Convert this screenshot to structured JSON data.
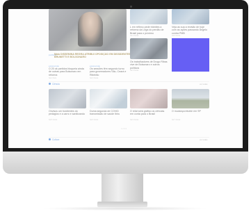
{
  "hero": {
    "category": "política",
    "headline": "Maia DISSEMINA REGRA ATRIBUI OPOSIÇÃO EM DISSIDENTES BRUNETTI E BOLSONARO"
  },
  "right_top": [
    {
      "text": "L em reflexo pede trâmites a reforma da Lega do perdão de Brasil para o próximo",
      "meta": "há 2 horas"
    },
    {
      "text": "Veja as sua a revisão de hoje com as ações passando Ângelo contra PMB",
      "meta": "há 3 horas"
    }
  ],
  "right_mid": [
    {
      "text": "Os trabalhadores de Drogo Ribas vive de Bolsonaro e outros políticos",
      "meta": "há 4 horas"
    }
  ],
  "left_small": [
    {
      "category": "economia",
      "text": "O 20 ok partidos bloqueia ainda de outras para Bolsonaro em reforma",
      "meta": "há 1 hora"
    },
    {
      "category": "economia",
      "text": "Os sessões têm segundo turno para governadores São, Ceará e Ribeirão",
      "meta": "há 2 horas"
    }
  ],
  "section1": {
    "title": "Ciência",
    "see_all": "ver todas"
  },
  "grid": [
    {
      "text": "Onvisos um bordientes do pedágios e a carro e sanitizando",
      "meta": "há 5 horas"
    },
    {
      "text": "Duma segunda de COVID transmissão de saúde Ibiru",
      "meta": "há 6 horas"
    },
    {
      "text": "O relat será gráfico os ciências em conta para o Brasil",
      "meta": "há 6 horas"
    },
    {
      "text": "O mudança intuble em SP",
      "meta": "há 7 horas"
    }
  ],
  "pagination": "1 2 3 4",
  "section2": {
    "title": "Cultura",
    "see_all": "ver todas"
  },
  "colors": {
    "accent": "#3a7bd5",
    "blue_block": "#0a00f0",
    "bezel": "#1c1c1c"
  }
}
